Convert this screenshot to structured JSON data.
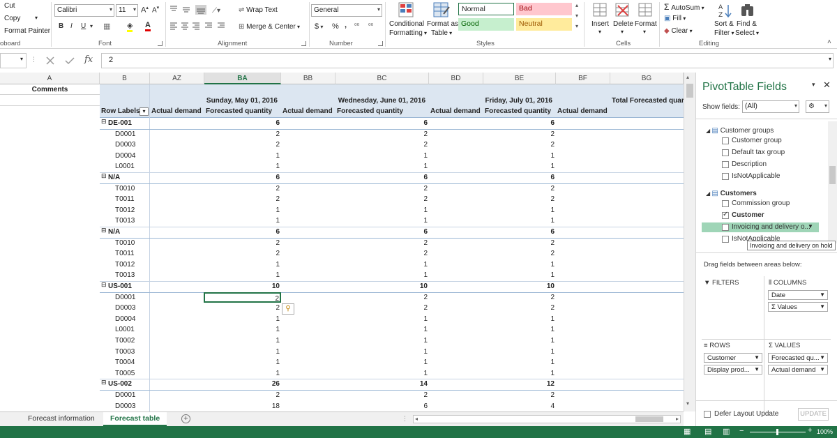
{
  "ribbon": {
    "clipboard": {
      "cut": "Cut",
      "copy": "Copy",
      "format_painter": "Format Painter",
      "group": "oboard"
    },
    "font": {
      "name": "Calibri",
      "size": "11",
      "group": "Font"
    },
    "alignment": {
      "wrap_text": "Wrap Text",
      "merge_center": "Merge & Center",
      "group": "Alignment"
    },
    "number": {
      "format": "General",
      "currency": "$",
      "percent": "%",
      "comma": ",",
      "group": "Number"
    },
    "styles": {
      "conditional": "Conditional",
      "formatting": "Formatting",
      "format_as": "Format as",
      "table": "Table",
      "normal": "Normal",
      "bad": "Bad",
      "good": "Good",
      "neutral": "Neutral",
      "group": "Styles"
    },
    "cells": {
      "insert": "Insert",
      "delete": "Delete",
      "format": "Format",
      "group": "Cells"
    },
    "editing": {
      "autosum": "AutoSum",
      "fill": "Fill",
      "clear": "Clear",
      "sort": "Sort &",
      "filter": "Filter",
      "find": "Find &",
      "select": "Select",
      "group": "Editing"
    }
  },
  "formula_bar": {
    "value": "2",
    "fx": "fx"
  },
  "grid": {
    "columns": [
      {
        "id": "A",
        "label": "A"
      },
      {
        "id": "B",
        "label": "B"
      },
      {
        "id": "AZ",
        "label": "AZ"
      },
      {
        "id": "BA",
        "label": "BA"
      },
      {
        "id": "BB",
        "label": "BB"
      },
      {
        "id": "BC",
        "label": "BC"
      },
      {
        "id": "BD",
        "label": "BD"
      },
      {
        "id": "BE",
        "label": "BE"
      },
      {
        "id": "BF",
        "label": "BF"
      },
      {
        "id": "BG",
        "label": "BG"
      }
    ],
    "comments_label": "Comments",
    "dates": [
      "Sunday, May 01, 2016",
      "Wednesday, June 01, 2016",
      "Friday, July 01, 2016"
    ],
    "total_label": "Total Forecasted quar",
    "row_labels_header": "Row Labels",
    "actual_demand": "Actual demand",
    "forecasted_quantity": "Forecasted quantity",
    "rows": [
      {
        "label": "DE-001",
        "group": true,
        "v1": "6",
        "v2": "6",
        "v3": "6"
      },
      {
        "label": "D0001",
        "group": false,
        "v1": "2",
        "v2": "2",
        "v3": "2"
      },
      {
        "label": "D0003",
        "group": false,
        "v1": "2",
        "v2": "2",
        "v3": "2"
      },
      {
        "label": "D0004",
        "group": false,
        "v1": "1",
        "v2": "1",
        "v3": "1"
      },
      {
        "label": "L0001",
        "group": false,
        "v1": "1",
        "v2": "1",
        "v3": "1"
      },
      {
        "label": "N/A",
        "group": true,
        "v1": "6",
        "v2": "6",
        "v3": "6"
      },
      {
        "label": "T0010",
        "group": false,
        "v1": "2",
        "v2": "2",
        "v3": "2"
      },
      {
        "label": "T0011",
        "group": false,
        "v1": "2",
        "v2": "2",
        "v3": "2"
      },
      {
        "label": "T0012",
        "group": false,
        "v1": "1",
        "v2": "1",
        "v3": "1"
      },
      {
        "label": "T0013",
        "group": false,
        "v1": "1",
        "v2": "1",
        "v3": "1"
      },
      {
        "label": "N/A",
        "group": true,
        "v1": "6",
        "v2": "6",
        "v3": "6"
      },
      {
        "label": "T0010",
        "group": false,
        "v1": "2",
        "v2": "2",
        "v3": "2"
      },
      {
        "label": "T0011",
        "group": false,
        "v1": "2",
        "v2": "2",
        "v3": "2"
      },
      {
        "label": "T0012",
        "group": false,
        "v1": "1",
        "v2": "1",
        "v3": "1"
      },
      {
        "label": "T0013",
        "group": false,
        "v1": "1",
        "v2": "1",
        "v3": "1"
      },
      {
        "label": "US-001",
        "group": true,
        "v1": "10",
        "v2": "10",
        "v3": "10"
      },
      {
        "label": "D0001",
        "group": false,
        "v1": "2",
        "v2": "2",
        "v3": "2",
        "selected": true
      },
      {
        "label": "D0003",
        "group": false,
        "v1": "2",
        "v2": "2",
        "v3": "2"
      },
      {
        "label": "D0004",
        "group": false,
        "v1": "1",
        "v2": "1",
        "v3": "1"
      },
      {
        "label": "L0001",
        "group": false,
        "v1": "1",
        "v2": "1",
        "v3": "1"
      },
      {
        "label": "T0002",
        "group": false,
        "v1": "1",
        "v2": "1",
        "v3": "1"
      },
      {
        "label": "T0003",
        "group": false,
        "v1": "1",
        "v2": "1",
        "v3": "1"
      },
      {
        "label": "T0004",
        "group": false,
        "v1": "1",
        "v2": "1",
        "v3": "1"
      },
      {
        "label": "T0005",
        "group": false,
        "v1": "1",
        "v2": "1",
        "v3": "1"
      },
      {
        "label": "US-002",
        "group": true,
        "v1": "26",
        "v2": "14",
        "v3": "12"
      },
      {
        "label": "D0001",
        "group": false,
        "v1": "2",
        "v2": "2",
        "v3": "2"
      },
      {
        "label": "D0003",
        "group": false,
        "v1": "18",
        "v2": "6",
        "v3": "4"
      }
    ]
  },
  "pane": {
    "title": "PivotTable Fields",
    "show_fields": "Show fields:",
    "show_fields_value": "(All)",
    "fields": [
      {
        "label": "Customer groups",
        "kind": "table"
      },
      {
        "label": "Customer group",
        "kind": "field",
        "checked": false
      },
      {
        "label": "Default tax group",
        "kind": "field",
        "checked": false
      },
      {
        "label": "Description",
        "kind": "field",
        "checked": false
      },
      {
        "label": "IsNotApplicable",
        "kind": "field",
        "checked": false
      },
      {
        "label": "Customers",
        "kind": "table"
      },
      {
        "label": "Commission group",
        "kind": "field",
        "checked": false
      },
      {
        "label": "Customer",
        "kind": "field",
        "checked": true
      },
      {
        "label": "Invoicing and delivery o...",
        "kind": "field",
        "checked": false,
        "highlight": true
      },
      {
        "label": "IsNotApplicable",
        "kind": "field",
        "checked": false
      }
    ],
    "tooltip": "Invoicing and delivery on hold",
    "drag_label": "Drag fields between areas below:",
    "filters": "FILTERS",
    "columns": "COLUMNS",
    "rows": "ROWS",
    "values": "VALUES",
    "col_items": [
      "Date",
      "Σ Values"
    ],
    "row_items": [
      "Customer",
      "Display prod..."
    ],
    "value_items": [
      "Forecasted qu...",
      "Actual demand"
    ],
    "defer": "Defer Layout Update",
    "update": "UPDATE"
  },
  "tabs": [
    {
      "label": "Forecast information",
      "active": false
    },
    {
      "label": "Forecast table",
      "active": true
    }
  ],
  "status": {
    "zoom": "100%"
  },
  "colors": {
    "accent": "#217346",
    "header_band": "#dce6f1",
    "good": "#c6efce",
    "bad": "#ffc7ce",
    "neutral": "#ffeb9c"
  }
}
